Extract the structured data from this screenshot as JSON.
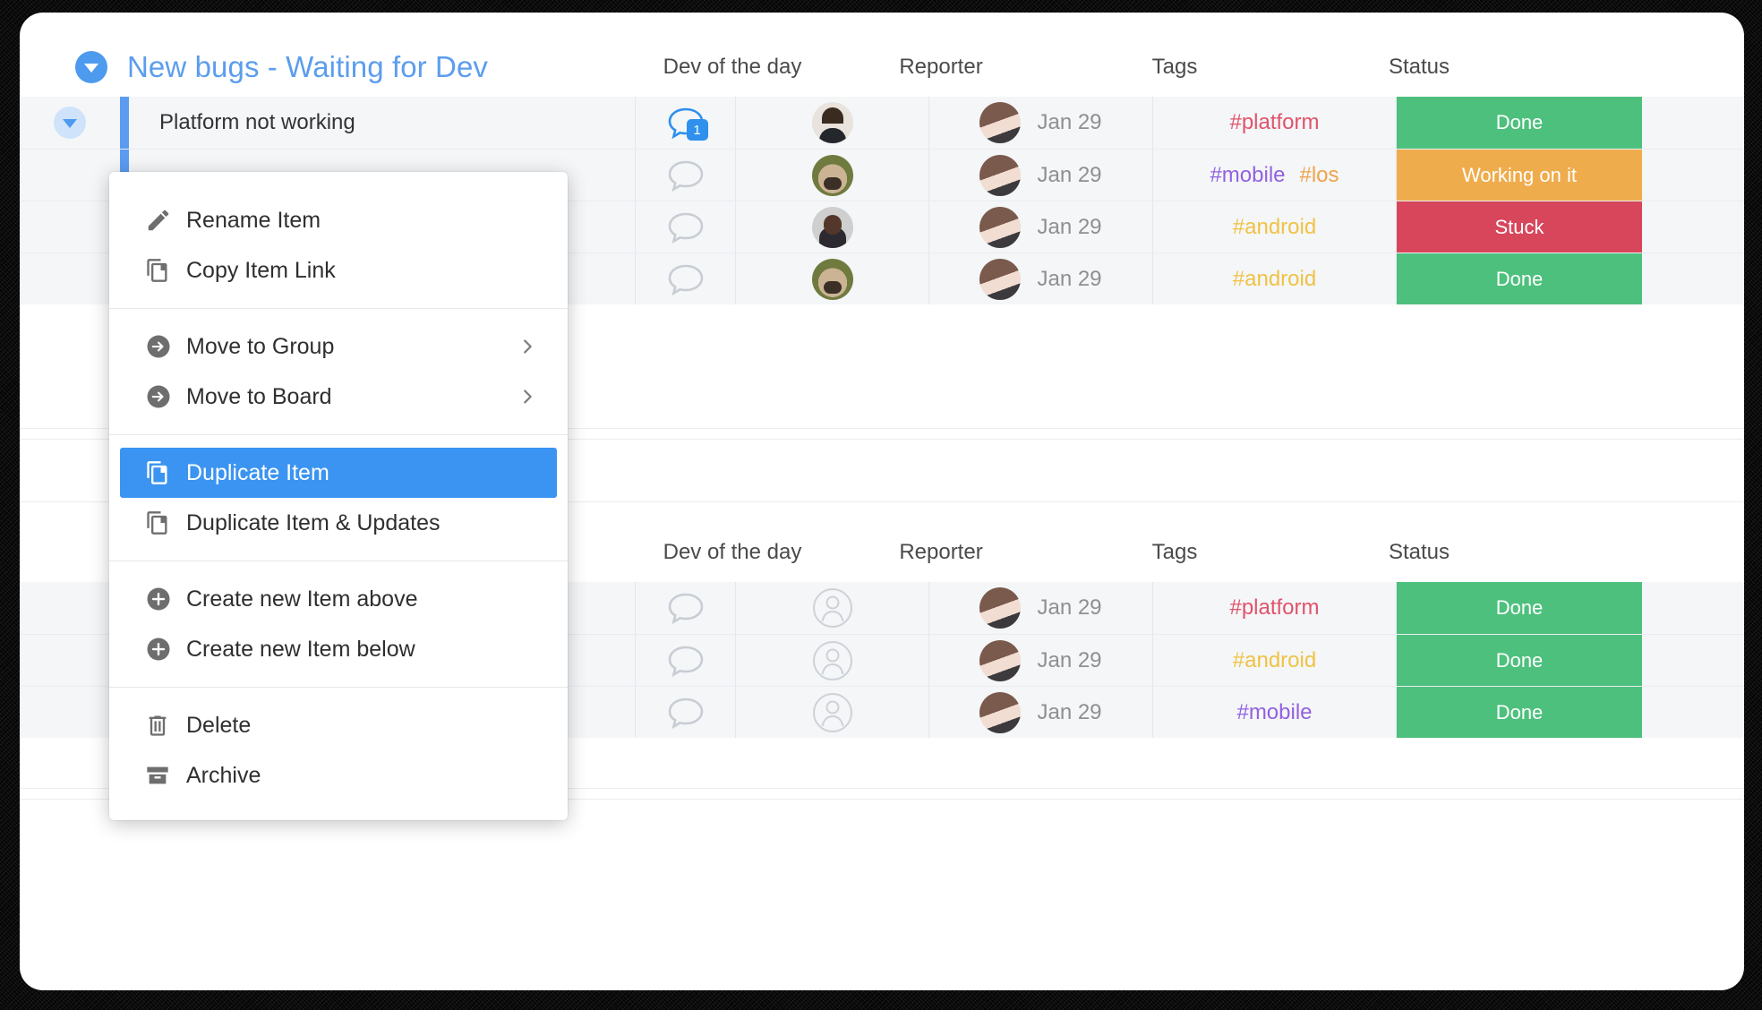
{
  "groups": [
    {
      "name": "New bugs - Waiting for Dev",
      "title_color": "#5c9ded",
      "columns": [
        "Dev of the day",
        "Reporter",
        "Tags",
        "Status"
      ],
      "rows": [
        {
          "title": "Platform not working",
          "comment_count": "1",
          "has_comments": true,
          "dev_avatar": "man-photo-avatar",
          "reporter_avatar": "woman-photo-avatar",
          "date": "Jan 29",
          "tags": [
            {
              "label": "#platform",
              "color": "#e1536a"
            }
          ],
          "status": {
            "label": "Done",
            "color": "#4ec07d"
          }
        },
        {
          "title": "",
          "comment_count": "",
          "has_comments": false,
          "dev_avatar": "pug-dog-photo-avatar",
          "reporter_avatar": "woman-photo-avatar",
          "date": "Jan 29",
          "tags": [
            {
              "label": "#mobile",
              "color": "#9361e0"
            },
            {
              "label": "#los",
              "color": "#f0a44a"
            }
          ],
          "status": {
            "label": "Working on it",
            "color": "#efac4d"
          }
        },
        {
          "title": "",
          "comment_count": "",
          "has_comments": false,
          "dev_avatar": "woman-glasses-photo-avatar",
          "reporter_avatar": "woman-photo-avatar",
          "date": "Jan 29",
          "tags": [
            {
              "label": "#android",
              "color": "#f0c244"
            }
          ],
          "status": {
            "label": "Stuck",
            "color": "#d7465b"
          }
        },
        {
          "title": "",
          "comment_count": "",
          "has_comments": false,
          "dev_avatar": "pug-dog-photo-avatar",
          "reporter_avatar": "woman-photo-avatar",
          "date": "Jan 29",
          "tags": [
            {
              "label": "#android",
              "color": "#f0c244"
            }
          ],
          "status": {
            "label": "Done",
            "color": "#4ec07d"
          }
        }
      ]
    },
    {
      "name": "",
      "title_color": "#5c9ded",
      "columns": [
        "Dev of the day",
        "Reporter",
        "Tags",
        "Status"
      ],
      "rows": [
        {
          "title": "",
          "comment_count": "",
          "has_comments": false,
          "dev_avatar": "person-placeholder-icon",
          "reporter_avatar": "woman-photo-avatar",
          "date": "Jan 29",
          "tags": [
            {
              "label": "#platform",
              "color": "#e1536a"
            }
          ],
          "status": {
            "label": "Done",
            "color": "#4ec07d"
          }
        },
        {
          "title": "",
          "comment_count": "",
          "has_comments": false,
          "dev_avatar": "person-placeholder-icon",
          "reporter_avatar": "woman-photo-avatar",
          "date": "Jan 29",
          "tags": [
            {
              "label": "#android",
              "color": "#f0c244"
            }
          ],
          "status": {
            "label": "Done",
            "color": "#4ec07d"
          }
        },
        {
          "title": "",
          "comment_count": "",
          "has_comments": false,
          "dev_avatar": "person-placeholder-icon",
          "reporter_avatar": "woman-photo-avatar",
          "date": "Jan 29",
          "tags": [
            {
              "label": "#mobile",
              "color": "#9361e0"
            }
          ],
          "status": {
            "label": "Done",
            "color": "#4ec07d"
          }
        }
      ]
    }
  ],
  "context_menu": {
    "highlight_color": "#3b94f1",
    "sections": [
      {
        "items": [
          {
            "label": "Rename Item",
            "icon": "pencil-icon",
            "submenu": false,
            "active": false
          },
          {
            "label": "Copy Item Link",
            "icon": "copy-icon",
            "submenu": false,
            "active": false
          }
        ]
      },
      {
        "items": [
          {
            "label": "Move to Group",
            "icon": "arrow-right-circle-icon",
            "submenu": true,
            "active": false
          },
          {
            "label": "Move to Board",
            "icon": "arrow-right-circle-icon",
            "submenu": true,
            "active": false
          }
        ]
      },
      {
        "items": [
          {
            "label": "Duplicate Item",
            "icon": "copy-icon",
            "submenu": false,
            "active": true
          },
          {
            "label": "Duplicate Item & Updates",
            "icon": "copy-icon",
            "submenu": false,
            "active": false
          }
        ]
      },
      {
        "items": [
          {
            "label": "Create new Item above",
            "icon": "plus-circle-icon",
            "submenu": false,
            "active": false
          },
          {
            "label": "Create new Item below",
            "icon": "plus-circle-icon",
            "submenu": false,
            "active": false
          }
        ]
      },
      {
        "items": [
          {
            "label": "Delete",
            "icon": "trash-icon",
            "submenu": false,
            "active": false
          },
          {
            "label": "Archive",
            "icon": "archive-icon",
            "submenu": false,
            "active": false
          }
        ]
      }
    ]
  }
}
